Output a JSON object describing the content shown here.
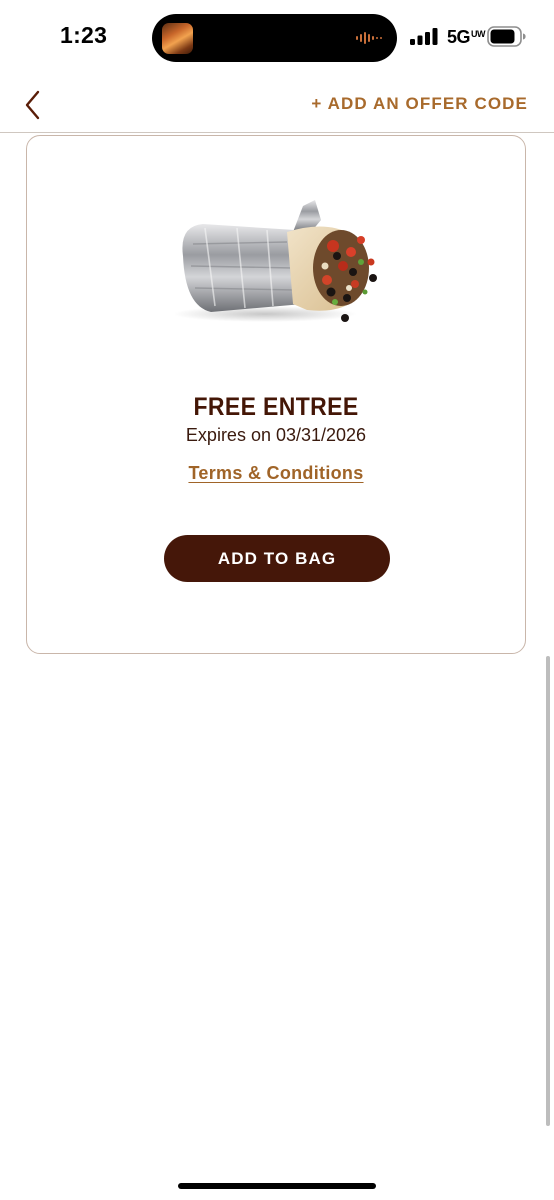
{
  "status_bar": {
    "time": "1:23",
    "network": "5G",
    "network_suffix": "UW"
  },
  "nav": {
    "back_icon": "chevron-left-icon",
    "offer_link": "+ ADD AN OFFER CODE"
  },
  "offer": {
    "image": "burrito-image",
    "title": "FREE ENTREE",
    "expiry": "Expires on 03/31/2026",
    "terms_link": "Terms & Conditions",
    "button": "ADD TO BAG"
  },
  "colors": {
    "brand_brown": "#451709",
    "accent_gold": "#a86a2c",
    "card_border": "#c9b6aa"
  }
}
